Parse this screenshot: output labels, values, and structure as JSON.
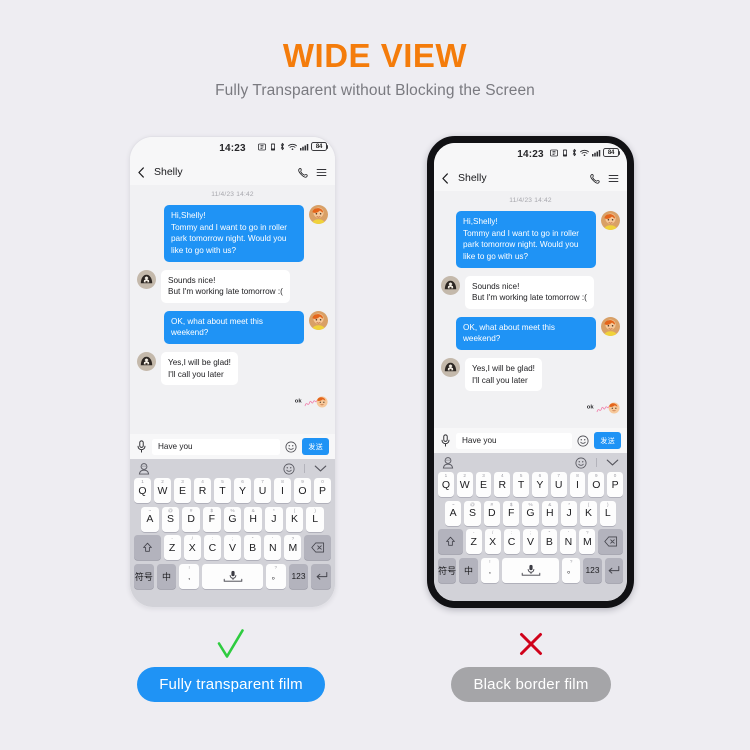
{
  "header": {
    "title": "WIDE VIEW",
    "subtitle": "Fully Transparent without Blocking the Screen",
    "title_color": "#f47c0b",
    "subtitle_color": "#7a7a80"
  },
  "background_color": "#eeedf2",
  "phone": {
    "status_bar": {
      "clock": "14:23",
      "battery_level": "84",
      "icons": [
        "alarm-icon",
        "vibrate-icon",
        "bluetooth-icon",
        "wifi-icon",
        "signal-icon",
        "battery-icon"
      ]
    },
    "chat_header": {
      "back_label": "back-icon",
      "peer_name": "Shelly",
      "call_icon": "phone-icon",
      "menu_icon": "hamburger-menu-icon"
    },
    "conversation": {
      "day_stamp": "11/4/23 14:42",
      "messages": [
        {
          "side": "out",
          "text": "Hi,Shelly!\nTommy and I want to go in roller park tomorrow night. Would you like to go with us?"
        },
        {
          "side": "in",
          "text": "Sounds nice!\nBut I'm working late tomorrow :("
        },
        {
          "side": "out",
          "text": "OK, what about meet this weekend?"
        },
        {
          "side": "in",
          "text": "Yes,I will be glad!\nI'll call you later"
        }
      ],
      "sticker_label": "ok"
    },
    "input_bar": {
      "mic_icon": "microphone-icon",
      "text_value": "Have you",
      "placeholder": "Have you",
      "emoji_icon": "emoji-smiley-icon",
      "send_label": "发送"
    },
    "keyboard": {
      "tools": {
        "sticker_icon": "sticker-face-icon",
        "emoji_icon": "emoji-smiley-icon",
        "collapse_icon": "chevron-down-icon"
      },
      "row1": [
        {
          "key": "Q",
          "hint": "1"
        },
        {
          "key": "W",
          "hint": "2"
        },
        {
          "key": "E",
          "hint": "3"
        },
        {
          "key": "R",
          "hint": "4"
        },
        {
          "key": "T",
          "hint": "5"
        },
        {
          "key": "Y",
          "hint": "6"
        },
        {
          "key": "U",
          "hint": "7"
        },
        {
          "key": "I",
          "hint": "8"
        },
        {
          "key": "O",
          "hint": "9"
        },
        {
          "key": "P",
          "hint": "0"
        }
      ],
      "row2": [
        {
          "key": "A",
          "hint": "~"
        },
        {
          "key": "S",
          "hint": "@"
        },
        {
          "key": "D",
          "hint": "#"
        },
        {
          "key": "F",
          "hint": "$"
        },
        {
          "key": "G",
          "hint": "%"
        },
        {
          "key": "H",
          "hint": "&"
        },
        {
          "key": "J",
          "hint": "*"
        },
        {
          "key": "K",
          "hint": "("
        },
        {
          "key": "L",
          "hint": ")"
        }
      ],
      "row3": {
        "shift": "shift-up-icon",
        "letters": [
          {
            "key": "Z",
            "hint": "-"
          },
          {
            "key": "X",
            "hint": "/"
          },
          {
            "key": "C",
            "hint": ":"
          },
          {
            "key": "V",
            "hint": ";"
          },
          {
            "key": "B",
            "hint": "\""
          },
          {
            "key": "N",
            "hint": "'"
          },
          {
            "key": "M",
            "hint": "?"
          }
        ],
        "backspace": "backspace-icon"
      },
      "row4": {
        "symbols": "符号",
        "lang": "中",
        "lang_sub": "英",
        "comma_hint": "!",
        "comma": ",",
        "space_icon": "microphone-icon",
        "period_hint": "?",
        "period": "。",
        "numbers": "123",
        "enter": "enter-return-icon"
      }
    }
  },
  "verdicts": [
    {
      "mark": "check-mark-icon",
      "mark_color": "#2ecc40",
      "label": "Fully transparent film",
      "pill_color": "#1f93f5"
    },
    {
      "mark": "cross-mark-icon",
      "mark_color": "#d0021b",
      "label": "Black border film",
      "pill_color": "#a5a5a8"
    }
  ]
}
